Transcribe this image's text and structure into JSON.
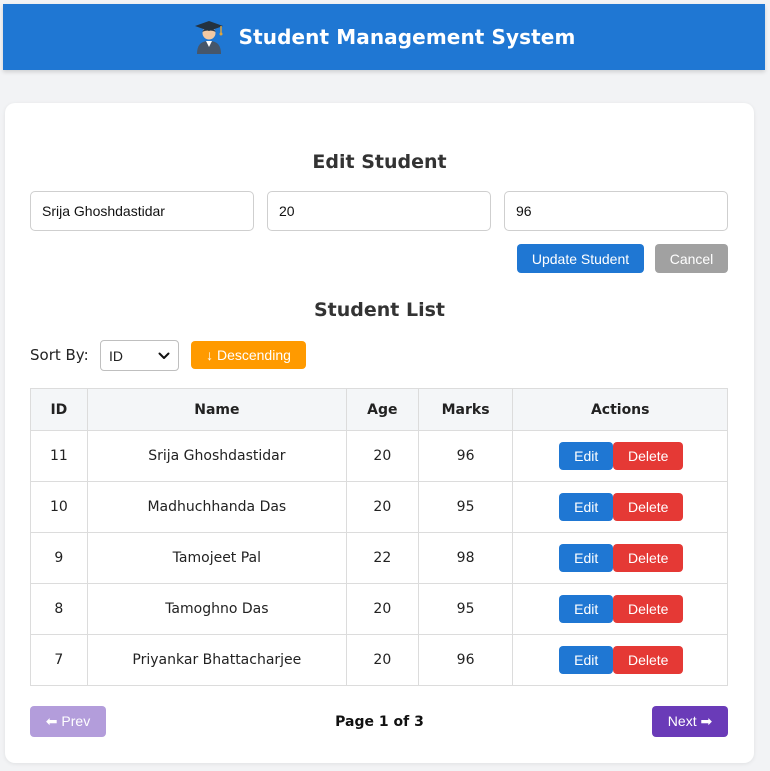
{
  "header": {
    "title": "Student Management System",
    "logo_icon": "graduate-student-icon",
    "background": "#1f77d3"
  },
  "edit_form": {
    "title": "Edit Student",
    "name_value": "Srija Ghoshdastidar",
    "age_value": "20",
    "marks_value": "96",
    "update_label": "Update Student",
    "cancel_label": "Cancel"
  },
  "list": {
    "title": "Student List",
    "sort_label": "Sort By:",
    "sort_value": "ID",
    "order_label": "↓ Descending",
    "columns": [
      "ID",
      "Name",
      "Age",
      "Marks",
      "Actions"
    ],
    "rows": [
      {
        "id": "11",
        "name": "Srija Ghoshdastidar",
        "age": "20",
        "marks": "96"
      },
      {
        "id": "10",
        "name": "Madhuchhanda Das",
        "age": "20",
        "marks": "95"
      },
      {
        "id": "9",
        "name": "Tamojeet Pal",
        "age": "22",
        "marks": "98"
      },
      {
        "id": "8",
        "name": "Tamoghno Das",
        "age": "20",
        "marks": "95"
      },
      {
        "id": "7",
        "name": "Priyankar Bhattacharjee",
        "age": "20",
        "marks": "96"
      }
    ],
    "edit_label": "Edit",
    "delete_label": "Delete"
  },
  "pagination": {
    "prev_label": "⬅ Prev",
    "page_info": "Page 1 of 3",
    "next_label": "Next ➡"
  },
  "colors": {
    "primary": "#1f77d3",
    "danger": "#e53935",
    "warning": "#ff9a00",
    "muted": "#a1a1a1",
    "purple": "#6a3bb8",
    "purple_disabled": "#b39ddb"
  }
}
